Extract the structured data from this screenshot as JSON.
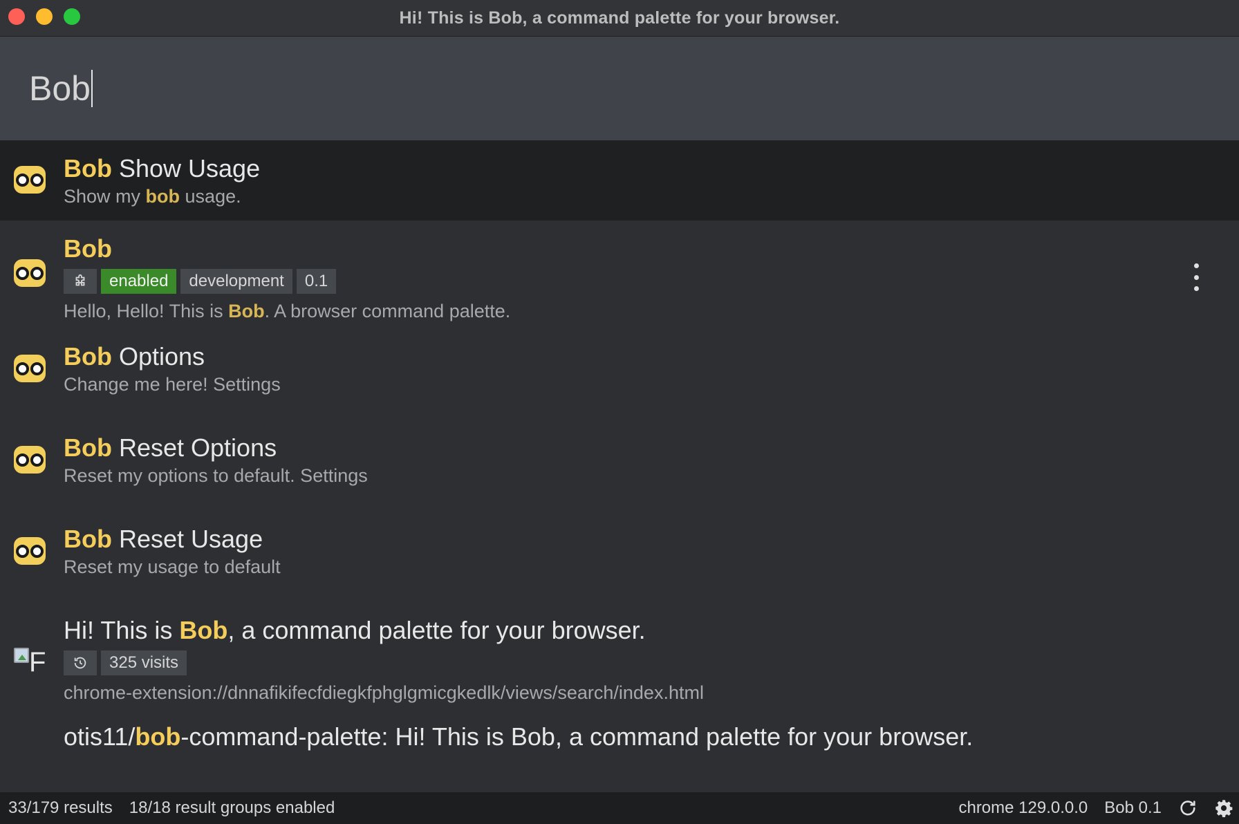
{
  "window": {
    "title": "Hi! This is Bob, a command palette for your browser."
  },
  "search": {
    "value": "Bob"
  },
  "results": [
    {
      "title_highlight": "Bob",
      "title_rest": " Show Usage",
      "desc_pre": "Show my ",
      "desc_highlight": "bob",
      "desc_post": " usage.",
      "icon": "bob-owl-icon"
    },
    {
      "title_highlight": "Bob",
      "title_rest": "",
      "tags": [
        "enabled",
        "development",
        "0.1"
      ],
      "tag_icon": "puzzle-icon",
      "desc_pre": "Hello, Hello! This is ",
      "desc_highlight": "Bob",
      "desc_post": ". A browser command palette.",
      "icon": "bob-owl-icon",
      "menu_icon": "more-vertical-icon"
    },
    {
      "title_highlight": "Bob",
      "title_rest": " Options",
      "desc": "Change me here! Settings",
      "icon": "bob-owl-icon"
    },
    {
      "title_highlight": "Bob",
      "title_rest": " Reset Options",
      "desc": "Reset my options to default. Settings",
      "icon": "bob-owl-icon"
    },
    {
      "title_highlight": "Bob",
      "title_rest": " Reset Usage",
      "desc": "Reset my usage to default",
      "icon": "bob-owl-icon"
    },
    {
      "title_pre": "Hi! This is ",
      "title_highlight": "Bob",
      "title_post": ", a command palette for your browser.",
      "tag_icon": "history-icon",
      "tags": [
        "325 visits"
      ],
      "desc": "chrome-extension://dnnafikifecfdiegkfphglgmicgkedlk/views/search/index.html",
      "icon": "broken-image-icon",
      "icon_alt": "F"
    },
    {
      "title_pre": "otis11/",
      "title_highlight": "bob",
      "title_post": "-command-palette: Hi! This is Bob, a command palette for your browser."
    }
  ],
  "status": {
    "results_count": "33/179 results",
    "groups_enabled": "18/18 result groups enabled",
    "browser": "chrome 129.0.0.0",
    "app_version": "Bob 0.1",
    "refresh_icon": "refresh-icon",
    "settings_icon": "gear-icon"
  }
}
